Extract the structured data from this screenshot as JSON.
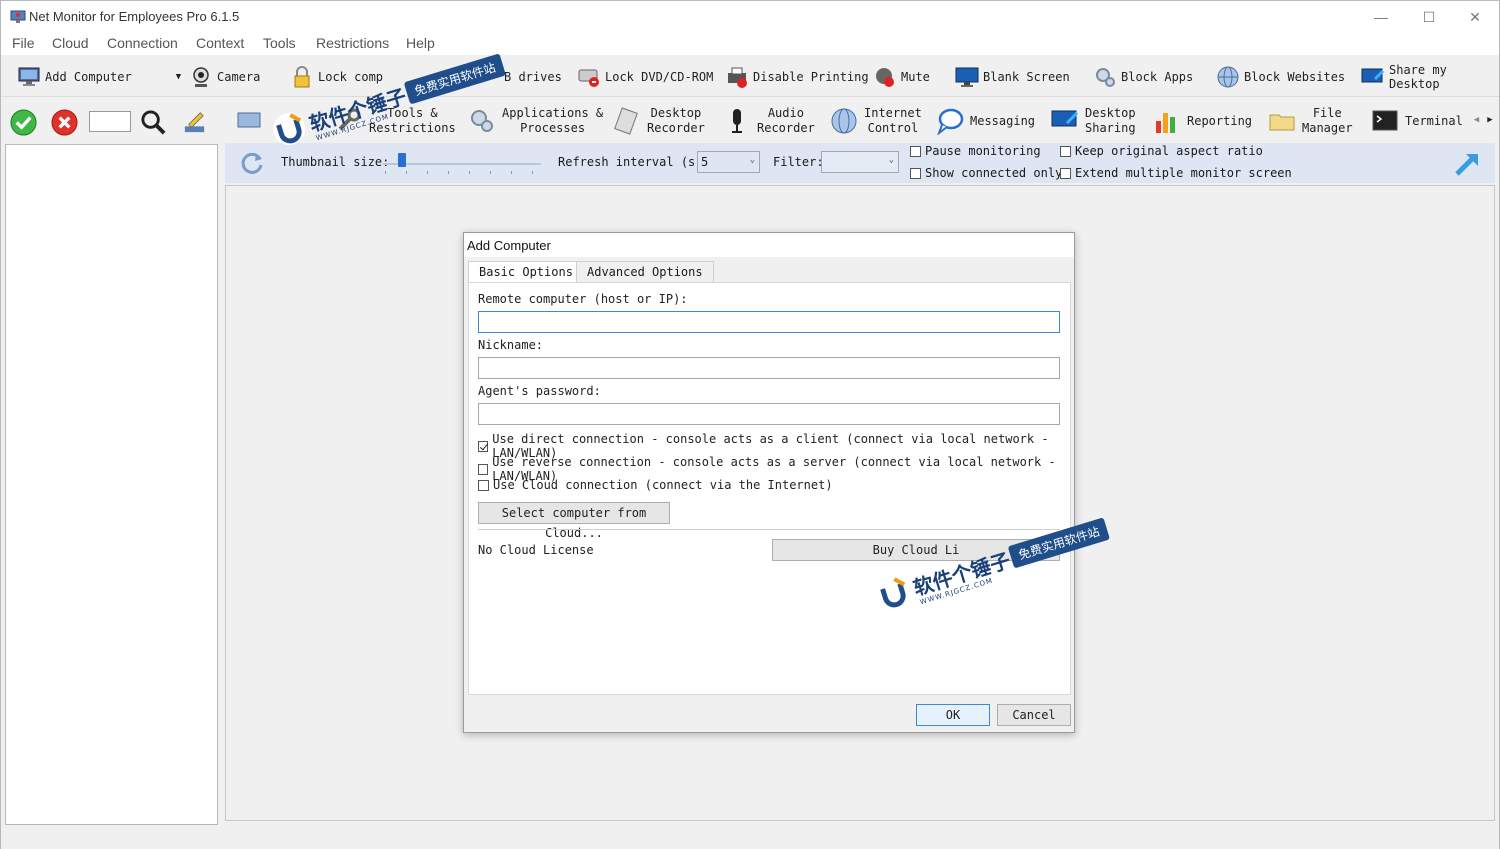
{
  "window": {
    "title": "Net Monitor for Employees Pro 6.1.5"
  },
  "menu": [
    "File",
    "Cloud",
    "Connection",
    "Context",
    "Tools",
    "Restrictions",
    "Help"
  ],
  "toolbar1": {
    "add_computer": "Add Computer",
    "camera": "Camera",
    "lock_computer": "Lock comp",
    "lock_drives": "B drives",
    "lock_dvd": "Lock DVD/CD-ROM",
    "disable_printing": "Disable Printing",
    "mute": "Mute",
    "blank_screen": "Blank Screen",
    "block_apps": "Block Apps",
    "block_websites": "Block Websites",
    "share_desktop": "Share my Desktop"
  },
  "toolbar2": {
    "tools_restrictions": [
      "Tools &",
      "Restrictions"
    ],
    "applications_processes": [
      "Applications &",
      "Processes"
    ],
    "desktop_recorder": [
      "Desktop",
      "Recorder"
    ],
    "audio_recorder": [
      "Audio",
      "Recorder"
    ],
    "internet_control": [
      "Internet",
      "Control"
    ],
    "messaging": "Messaging",
    "desktop_sharing": [
      "Desktop",
      "Sharing"
    ],
    "reporting": "Reporting",
    "file_manager": [
      "File",
      "Manager"
    ],
    "terminal": "Terminal"
  },
  "options": {
    "thumbnail_label": "Thumbnail size:",
    "thumbnail_level": 0.1,
    "refresh_label": "Refresh interval (s):",
    "refresh_value": "5",
    "filter_label": "Filter:",
    "filter_value": "",
    "pause_monitoring": {
      "label": "Pause monitoring",
      "checked": false
    },
    "show_connected_only": {
      "label": "Show connected only",
      "checked": false
    },
    "keep_aspect": {
      "label": "Keep original aspect ratio",
      "checked": false
    },
    "extend_monitor": {
      "label": "Extend multiple monitor screen",
      "checked": false
    }
  },
  "dialog": {
    "title": "Add Computer",
    "tabs": [
      "Basic Options",
      "Advanced Options"
    ],
    "remote_label": "Remote computer (host or IP):",
    "remote_value": "",
    "nickname_label": "Nickname:",
    "nickname_value": "",
    "password_label": "Agent's password:",
    "password_value": "",
    "conn_direct": {
      "label": "Use direct connection - console acts as a client (connect via local network - LAN/WLAN)",
      "checked": true
    },
    "conn_reverse": {
      "label": "Use reverse connection - console acts as a server (connect via local network - LAN/WLAN)",
      "checked": false
    },
    "conn_cloud": {
      "label": "Use Cloud connection (connect via the Internet)",
      "checked": false
    },
    "select_cloud_button": "Select computer from Cloud...",
    "license_status": "No Cloud License",
    "buy_cloud_button": "Buy Cloud Li",
    "ok_button": "OK",
    "cancel_button": "Cancel"
  },
  "watermark": {
    "main": "软件个锤子",
    "sub": "免费实用软件站",
    "site": "WWW.RJGCZ.COM"
  },
  "colors": {
    "accent": "#3c8ad6",
    "options_bar": "#dde6f2",
    "watermark_blue": "#1f4e8a"
  }
}
